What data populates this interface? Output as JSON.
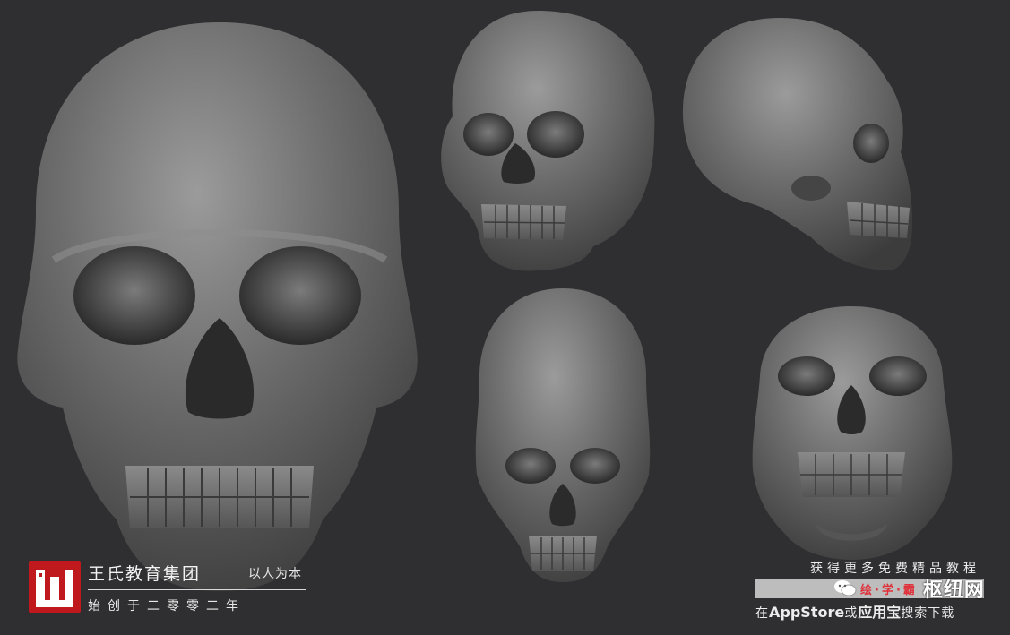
{
  "scene": {
    "background_color": "#2f2f31",
    "skull_color": "#6a6a6a",
    "views": [
      {
        "name": "front-view-large"
      },
      {
        "name": "three-quarter-view"
      },
      {
        "name": "side-view"
      },
      {
        "name": "top-front-view"
      },
      {
        "name": "bottom-front-view"
      }
    ]
  },
  "logo": {
    "brand_name": "王氏教育集团",
    "slogan": "以人为本",
    "founded": "始创于二零零二年",
    "mark_color": "#c0191d",
    "icon": "logo-mark-icon"
  },
  "promo": {
    "title": "获得更多免费精品教程",
    "download_prefix": "在",
    "download_store": "AppStore",
    "download_or": "或",
    "download_app": "应用宝",
    "download_suffix": "搜索下载",
    "watermark_red": "绘·学·霸",
    "watermark_cn": "枢纽网",
    "icon": "wechat-icon"
  }
}
